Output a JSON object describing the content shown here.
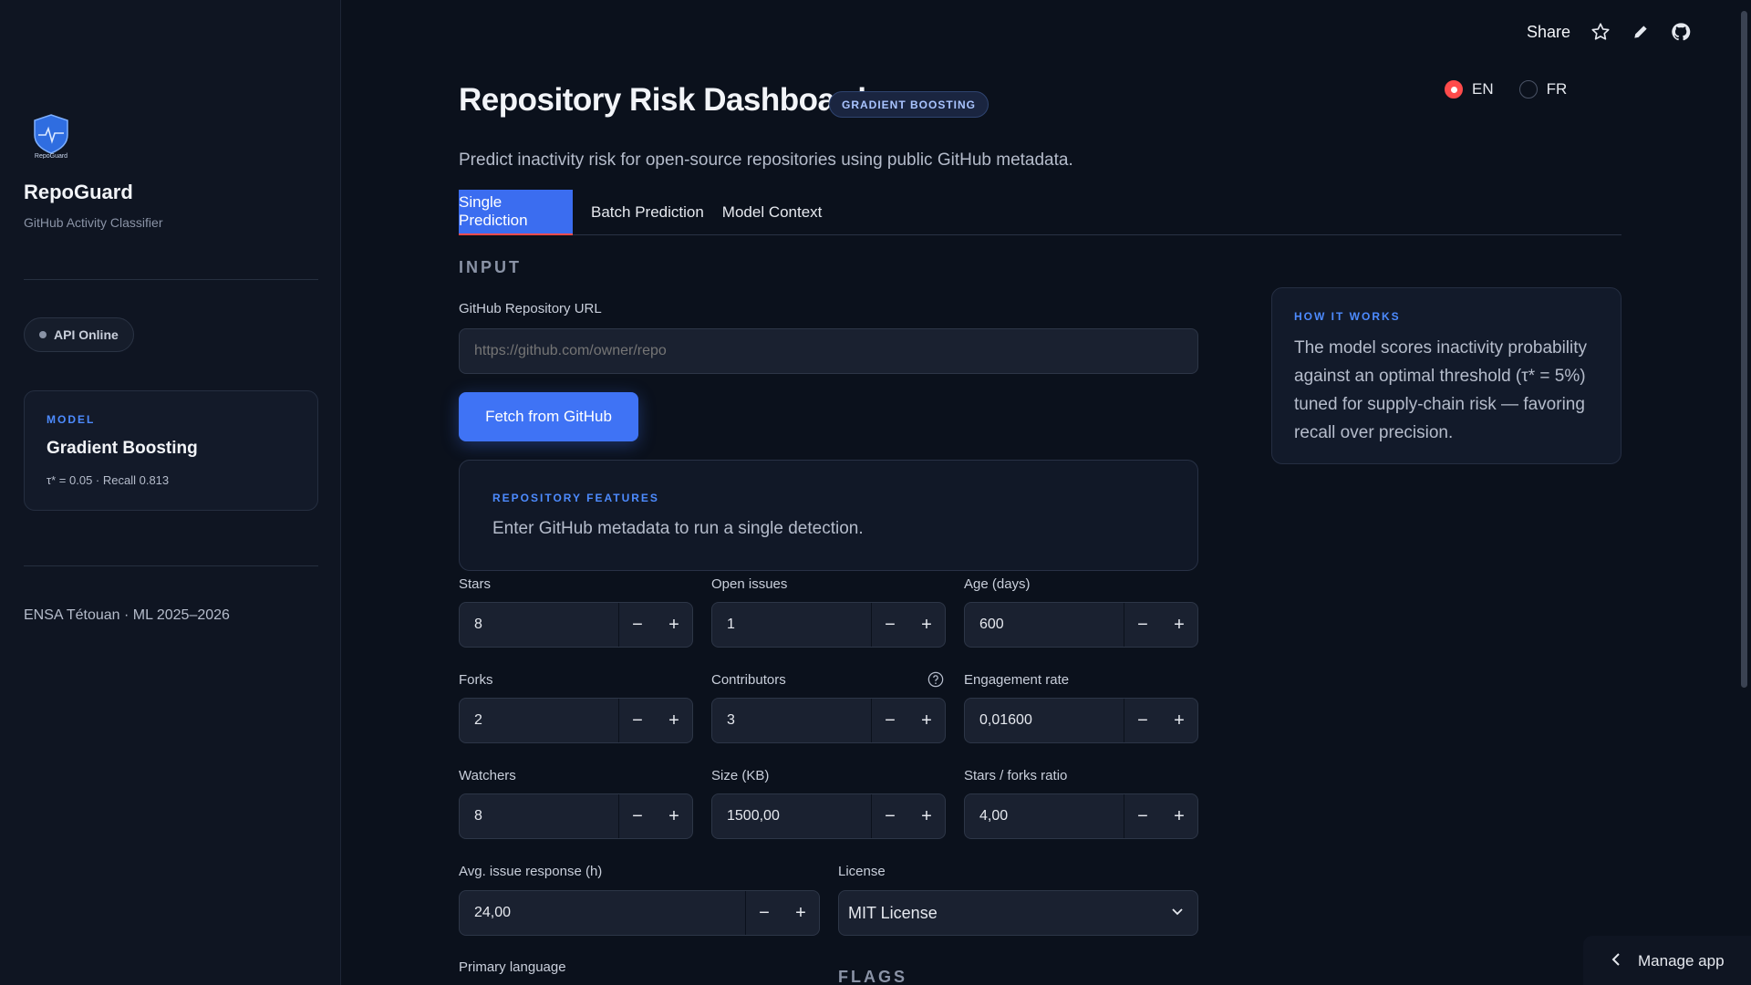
{
  "sidebar": {
    "logo_text": "RepoGuard",
    "brand_title": "RepoGuard",
    "brand_subtitle": "GitHub Activity Classifier",
    "api_status": "API Online",
    "model_card": {
      "eyebrow": "MODEL",
      "name": "Gradient Boosting",
      "meta": "τ* = 0.05 · Recall 0.813"
    },
    "footer": "ENSA Tétouan · ML 2025–2026"
  },
  "toolbar": {
    "share_label": "Share",
    "icons": [
      "star-icon",
      "pencil-icon",
      "github-icon"
    ]
  },
  "language": {
    "options": [
      "EN",
      "FR"
    ],
    "selected": "EN"
  },
  "header": {
    "title": "Repository Risk Dashboard",
    "badge": "GRADIENT BOOSTING",
    "subtitle": "Predict inactivity risk for open-source repositories using public GitHub metadata."
  },
  "tabs": [
    {
      "label": "Single Prediction",
      "active": true
    },
    {
      "label": "Batch Prediction",
      "active": false
    },
    {
      "label": "Model Context",
      "active": false
    }
  ],
  "input": {
    "section_label": "INPUT",
    "url_label": "GitHub Repository URL",
    "url_placeholder": "https://github.com/owner/repo",
    "fetch_label": "Fetch from GitHub",
    "features_card": {
      "eyebrow": "REPOSITORY FEATURES",
      "text": "Enter GitHub metadata to run a single detection."
    },
    "fields": {
      "stars": {
        "label": "Stars",
        "value": "8"
      },
      "open_issues": {
        "label": "Open issues",
        "value": "1"
      },
      "age": {
        "label": "Age (days)",
        "value": "600"
      },
      "forks": {
        "label": "Forks",
        "value": "2"
      },
      "contributors": {
        "label": "Contributors",
        "value": "3"
      },
      "engagement": {
        "label": "Engagement rate",
        "value": "0,01600"
      },
      "watchers": {
        "label": "Watchers",
        "value": "8"
      },
      "size": {
        "label": "Size (KB)",
        "value": "1500,00"
      },
      "stars_forks": {
        "label": "Stars / forks ratio",
        "value": "4,00"
      },
      "issue_response": {
        "label": "Avg. issue response (h)",
        "value": "24,00"
      }
    },
    "license": {
      "label": "License",
      "value": "MIT License"
    },
    "primary_language_label": "Primary language",
    "flags_label": "FLAGS"
  },
  "how_it_works": {
    "eyebrow": "HOW IT WORKS",
    "text": "The model scores inactivity probability against an optimal threshold (τ* = 5%) tuned for supply-chain risk — favoring recall over precision."
  },
  "stepper": {
    "minus": "−",
    "plus": "+"
  },
  "manage_app_label": "Manage app",
  "colors": {
    "accent": "#3f73f5",
    "eyebrow_blue": "#4d8bff",
    "radio_selected": "#ff4b4b",
    "background": "#0b111c"
  }
}
